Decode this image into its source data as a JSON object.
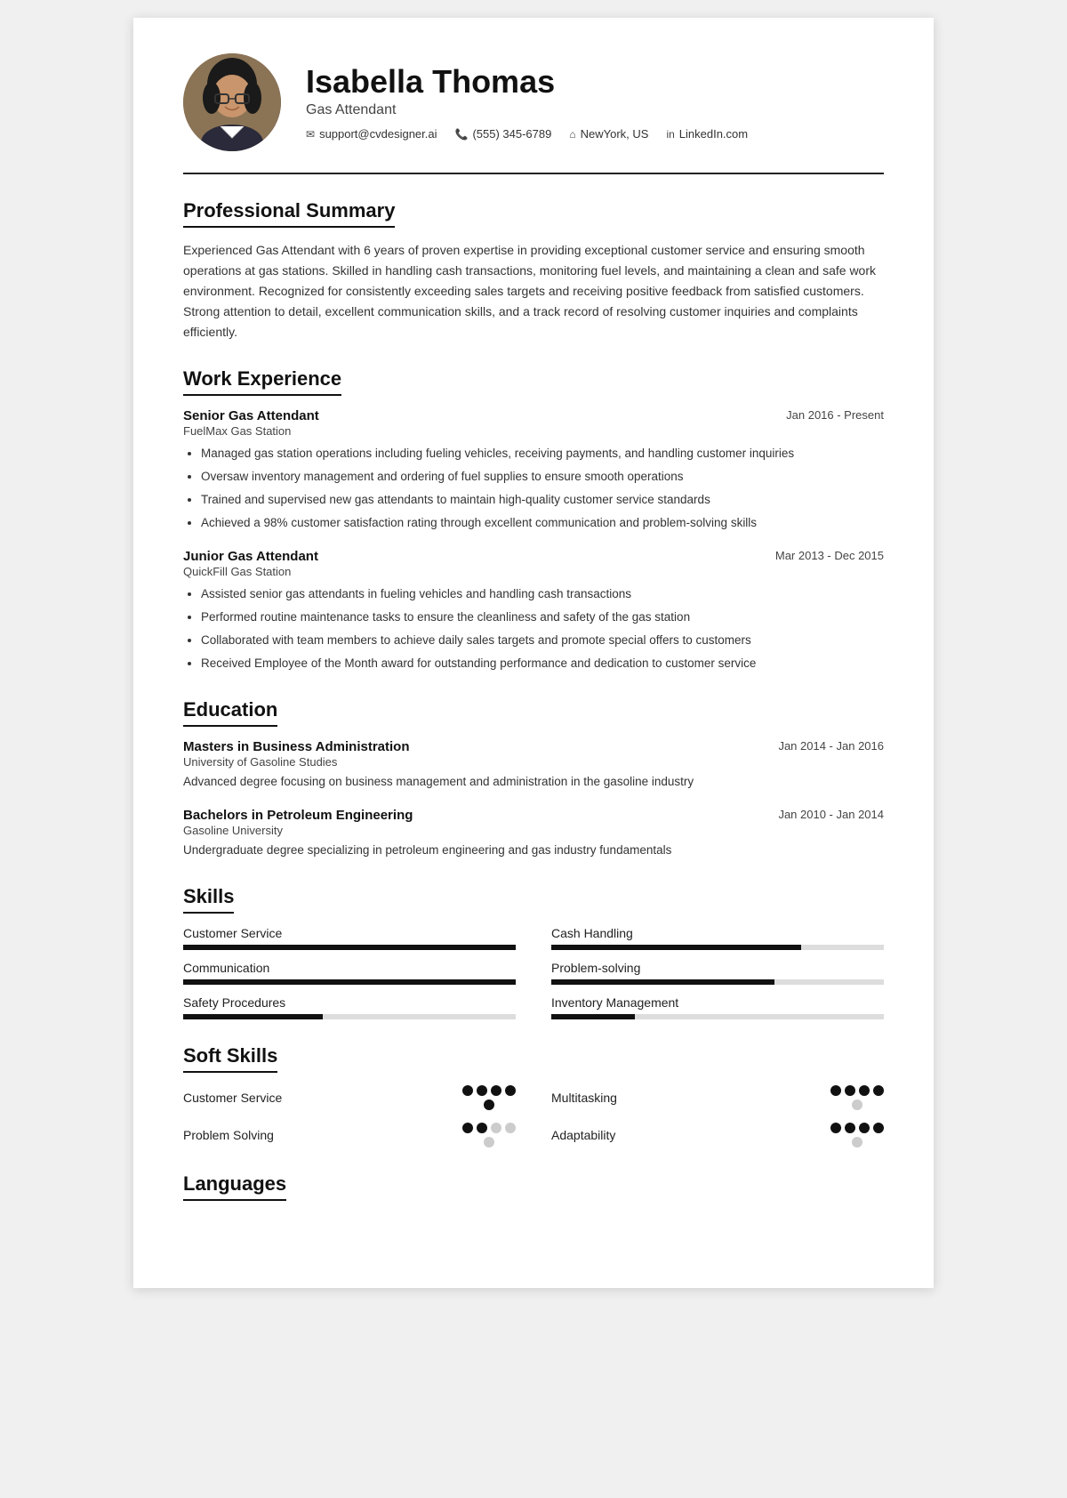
{
  "header": {
    "name": "Isabella Thomas",
    "title": "Gas Attendant",
    "contact": {
      "email": "support@cvdesigner.ai",
      "phone": "(555) 345-6789",
      "location": "NewYork, US",
      "linkedin": "LinkedIn.com"
    }
  },
  "sections": {
    "professional_summary": {
      "label": "Professional Summary",
      "text": "Experienced Gas Attendant with 6 years of proven expertise in providing exceptional customer service and ensuring smooth operations at gas stations. Skilled in handling cash transactions, monitoring fuel levels, and maintaining a clean and safe work environment. Recognized for consistently exceeding sales targets and receiving positive feedback from satisfied customers. Strong attention to detail, excellent communication skills, and a track record of resolving customer inquiries and complaints efficiently."
    },
    "work_experience": {
      "label": "Work Experience",
      "jobs": [
        {
          "title": "Senior Gas Attendant",
          "company": "FuelMax Gas Station",
          "date": "Jan 2016 - Present",
          "bullets": [
            "Managed gas station operations including fueling vehicles, receiving payments, and handling customer inquiries",
            "Oversaw inventory management and ordering of fuel supplies to ensure smooth operations",
            "Trained and supervised new gas attendants to maintain high-quality customer service standards",
            "Achieved a 98% customer satisfaction rating through excellent communication and problem-solving skills"
          ]
        },
        {
          "title": "Junior Gas Attendant",
          "company": "QuickFill Gas Station",
          "date": "Mar 2013 - Dec 2015",
          "bullets": [
            "Assisted senior gas attendants in fueling vehicles and handling cash transactions",
            "Performed routine maintenance tasks to ensure the cleanliness and safety of the gas station",
            "Collaborated with team members to achieve daily sales targets and promote special offers to customers",
            "Received Employee of the Month award for outstanding performance and dedication to customer service"
          ]
        }
      ]
    },
    "education": {
      "label": "Education",
      "items": [
        {
          "degree": "Masters in Business Administration",
          "school": "University of Gasoline Studies",
          "date": "Jan 2014 - Jan 2016",
          "desc": "Advanced degree focusing on business management and administration in the gasoline industry"
        },
        {
          "degree": "Bachelors in Petroleum Engineering",
          "school": "Gasoline University",
          "date": "Jan 2010 - Jan 2014",
          "desc": "Undergraduate degree specializing in petroleum engineering and gas industry fundamentals"
        }
      ]
    },
    "skills": {
      "label": "Skills",
      "items": [
        {
          "label": "Customer Service",
          "fill": 100,
          "col": 0
        },
        {
          "label": "Cash Handling",
          "fill": 75,
          "col": 1
        },
        {
          "label": "Communication",
          "fill": 100,
          "col": 0
        },
        {
          "label": "Problem-solving",
          "fill": 67,
          "col": 1
        },
        {
          "label": "Safety Procedures",
          "fill": 42,
          "col": 0
        },
        {
          "label": "Inventory Management",
          "fill": 25,
          "col": 1
        }
      ]
    },
    "soft_skills": {
      "label": "Soft Skills",
      "items": [
        {
          "label": "Customer Service",
          "dots": [
            true,
            true,
            true,
            true
          ],
          "extra_dot": true,
          "extra_dot_filled": false,
          "col": 0
        },
        {
          "label": "Multitasking",
          "dots": [
            true,
            true,
            true,
            true
          ],
          "extra_dot": true,
          "extra_dot_filled": false,
          "col": 1
        },
        {
          "label": "Problem Solving",
          "dots": [
            true,
            true,
            false,
            false
          ],
          "extra_dot": true,
          "extra_dot_filled": false,
          "col": 0
        },
        {
          "label": "Adaptability",
          "dots": [
            true,
            true,
            true,
            true
          ],
          "extra_dot": true,
          "extra_dot_filled": false,
          "col": 1
        }
      ]
    },
    "languages": {
      "label": "Languages"
    }
  }
}
